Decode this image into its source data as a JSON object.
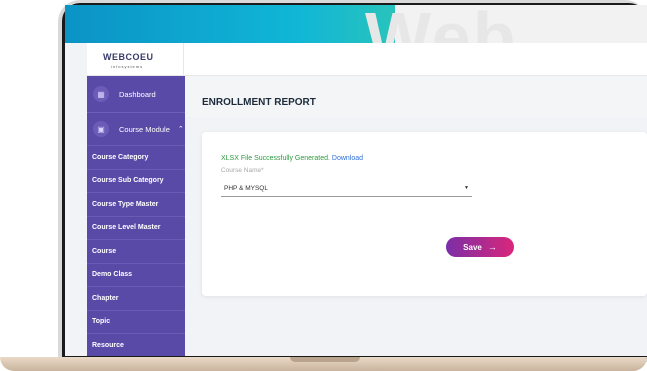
{
  "brand": {
    "logo_text": "WEBCOEU",
    "logo_subtext": "infosystems",
    "watermark": "Web"
  },
  "sidebar": {
    "dashboard_label": "Dashboard",
    "module_label": "Course Module",
    "items": [
      {
        "label": "Course Category"
      },
      {
        "label": "Course Sub Category"
      },
      {
        "label": "Course Type Master"
      },
      {
        "label": "Course Level Master"
      },
      {
        "label": "Course"
      },
      {
        "label": "Demo Class"
      },
      {
        "label": "Chapter"
      },
      {
        "label": "Topic"
      },
      {
        "label": "Resource"
      }
    ]
  },
  "main": {
    "title": "ENROLLMENT REPORT",
    "success_message": "XLSX File Successfully Generated.",
    "download_link": "Download",
    "course_label": "Course Name*",
    "course_value": "PHP & MYSQL",
    "save_label": "Save"
  },
  "colors": {
    "sidebar": "#5a4aa8",
    "success": "#2e9b3e",
    "link": "#2f6fd8",
    "save_gradient_start": "#7b2ea7",
    "save_gradient_end": "#d9277b"
  }
}
